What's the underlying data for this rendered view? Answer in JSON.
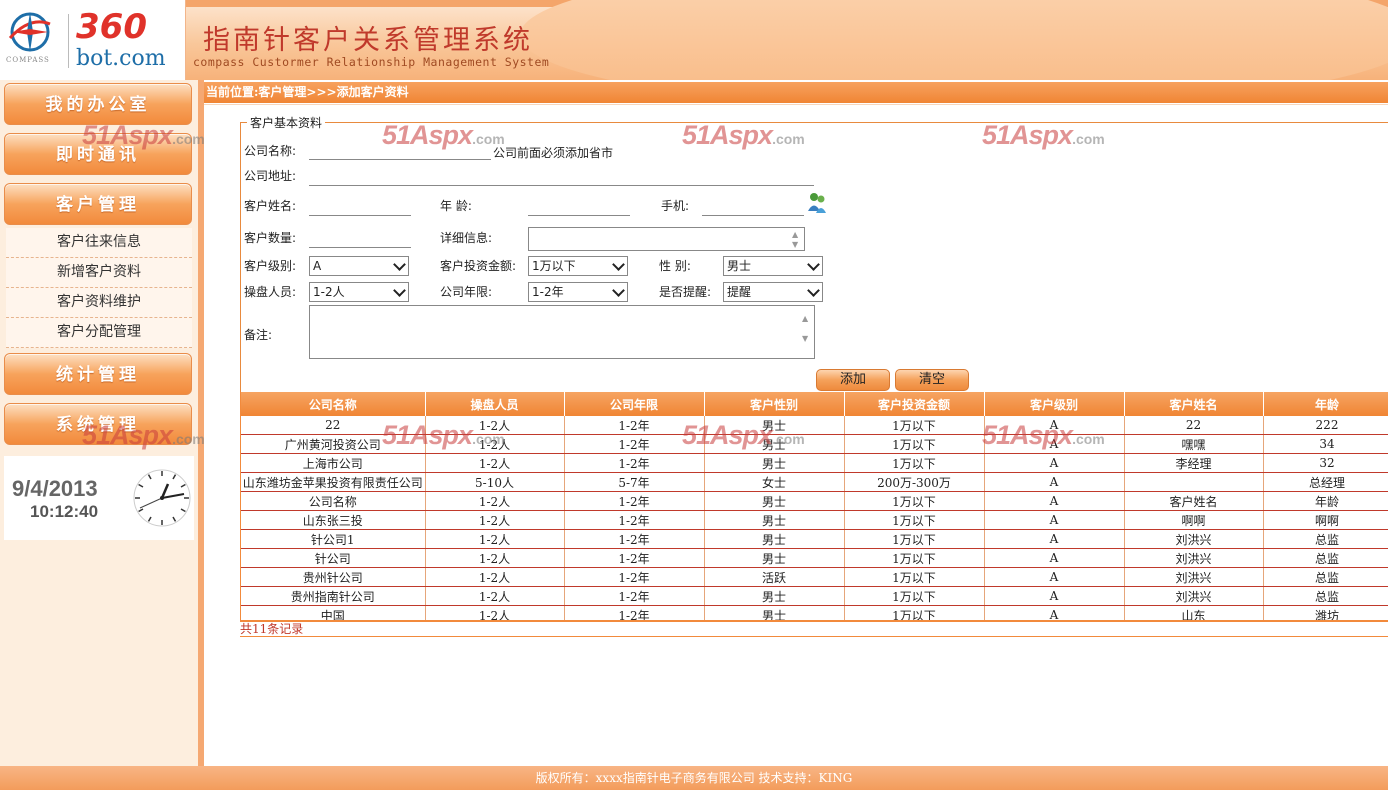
{
  "header": {
    "logo_top": "360",
    "logo_bottom": "bot.com",
    "compass_label": "COMPASS",
    "title": "指南针客户关系管理系统",
    "subtitle": "compass Custormer Relationship Management System"
  },
  "sidebar": {
    "menu": [
      "我的办公室",
      "即时通讯",
      "客户管理",
      "统计管理",
      "系统管理"
    ],
    "submenu": [
      "客户往来信息",
      "新增客户资料",
      "客户资料维护",
      "客户分配管理"
    ]
  },
  "clock": {
    "date": "9/4/2013",
    "time": "10:12:40"
  },
  "location": "当前位置:客户管理>>>添加客户资料",
  "form": {
    "legend": "客户基本资料",
    "company_name_label": "公司名称:",
    "company_name_hint": "公司前面必须添加省市",
    "company_address_label": "公司地址:",
    "customer_name_label": "客户姓名:",
    "age_label": "年  龄:",
    "phone_label": "手机:",
    "customer_count_label": "客户数量:",
    "detail_label": "详细信息:",
    "level_label": "客户级别:",
    "level_value": "A",
    "investment_label": "客户投资金额:",
    "investment_value": "1万以下",
    "gender_label": "性  别:",
    "gender_value": "男士",
    "operator_label": "操盘人员:",
    "operator_value": "1-2人",
    "years_label": "公司年限:",
    "years_value": "1-2年",
    "remind_label": "是否提醒:",
    "remind_value": "提醒",
    "remark_label": "备注:",
    "add_button": "添加",
    "clear_button": "清空"
  },
  "table": {
    "columns": [
      "公司名称",
      "操盘人员",
      "公司年限",
      "客户性别",
      "客户投资金额",
      "客户级别",
      "客户姓名",
      "年龄"
    ],
    "rows": [
      [
        "22",
        "1-2人",
        "1-2年",
        "男士",
        "1万以下",
        "A",
        "22",
        "222"
      ],
      [
        "广州黄河投资公司",
        "1-2人",
        "1-2年",
        "男士",
        "1万以下",
        "A",
        "嘿嘿",
        "34"
      ],
      [
        "上海市公司",
        "1-2人",
        "1-2年",
        "男士",
        "1万以下",
        "A",
        "李经理",
        "32"
      ],
      [
        "山东潍坊金苹果投资有限责任公司",
        "5-10人",
        "5-7年",
        "女士",
        "200万-300万",
        "A",
        "",
        "总经理"
      ],
      [
        "公司名称",
        "1-2人",
        "1-2年",
        "男士",
        "1万以下",
        "A",
        "客户姓名",
        "年龄"
      ],
      [
        "山东张三投",
        "1-2人",
        "1-2年",
        "男士",
        "1万以下",
        "A",
        "啊啊",
        "啊啊"
      ],
      [
        "针公司1",
        "1-2人",
        "1-2年",
        "男士",
        "1万以下",
        "A",
        "刘洪兴",
        "总监"
      ],
      [
        "针公司",
        "1-2人",
        "1-2年",
        "男士",
        "1万以下",
        "A",
        "刘洪兴",
        "总监"
      ],
      [
        "贵州针公司",
        "1-2人",
        "1-2年",
        "活跃",
        "1万以下",
        "A",
        "刘洪兴",
        "总监"
      ],
      [
        "贵州指南针公司",
        "1-2人",
        "1-2年",
        "男士",
        "1万以下",
        "A",
        "刘洪兴",
        "总监"
      ],
      [
        "中国",
        "1-2人",
        "1-2年",
        "男士",
        "1万以下",
        "A",
        "山东",
        "潍坊"
      ]
    ],
    "record_count": "共11条记录"
  },
  "watermark": {
    "brand": "51Aspx",
    "suffix": ".com"
  },
  "footer": "版权所有：xxxx指南针电子商务有限公司  技术支持：KING",
  "colors": {
    "accent": "#f28a3c",
    "title_red": "#c0392b",
    "link_blue": "#1e6ea8"
  }
}
